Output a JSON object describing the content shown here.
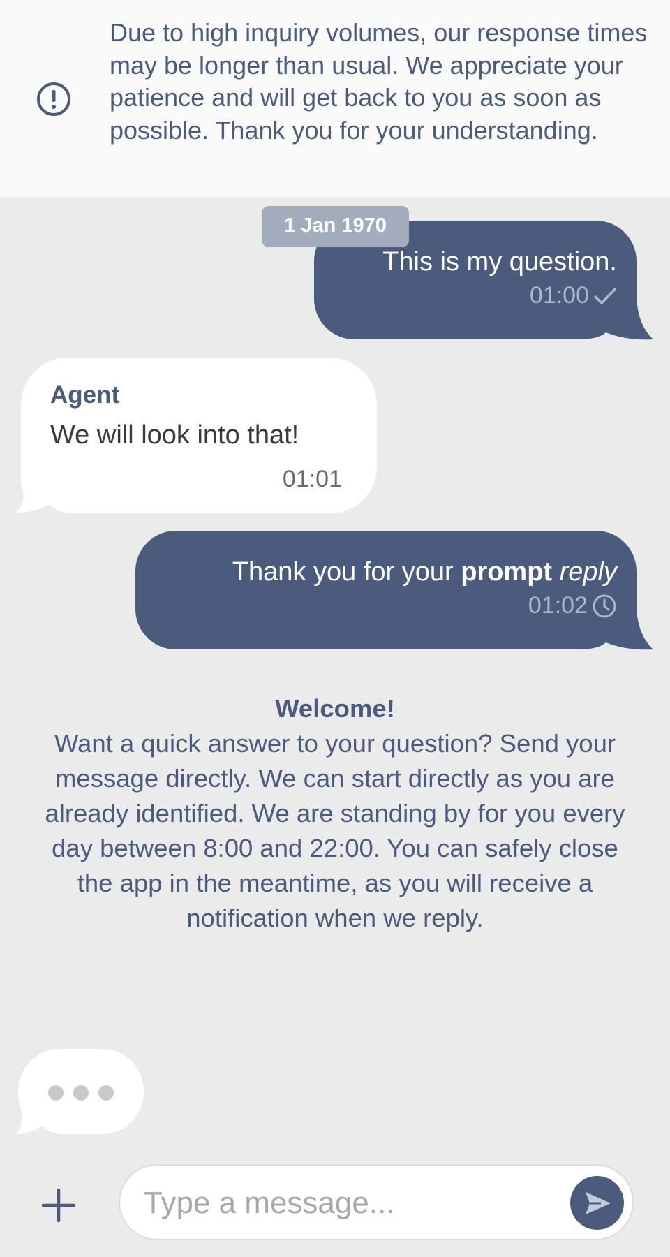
{
  "banner": {
    "icon": "exclamation-circle-icon",
    "text": "Due to high inquiry volumes, our response times may be longer than usual. We appreciate your patience and will get back to you as soon as possible. Thank you for your understanding."
  },
  "date_badge": "1 Jan 1970",
  "messages": [
    {
      "direction": "outgoing",
      "text": "This is my question.",
      "time": "01:00",
      "status_icon": "checkmark-icon"
    },
    {
      "direction": "incoming",
      "sender": "Agent",
      "text": "We will look into that!",
      "time": "01:01"
    },
    {
      "direction": "outgoing",
      "text_parts": {
        "plain": "Thank you for your ",
        "bold": "prompt",
        "space": " ",
        "italic": "reply"
      },
      "time": "01:02",
      "status_icon": "clock-icon"
    }
  ],
  "welcome": {
    "title": "Welcome!",
    "body": "Want a quick answer to your question? Send your message directly. We can start directly as you are already identified. We are standing by for you every day between 8:00 and 22:00. You can safely close the app in the meantime, as you will receive a notification when we reply."
  },
  "typing_indicator": "typing-dots-icon",
  "composer": {
    "add_icon": "plus-icon",
    "placeholder": "Type a message...",
    "value": "",
    "send_icon": "send-arrow-icon"
  },
  "colors": {
    "background": "#ebebeb",
    "banner_bg": "#fafafa",
    "primary": "#4b5b7e",
    "outgoing_bubble": "#4b5b7e",
    "incoming_bubble": "#ffffff",
    "date_badge": "#a3acbd"
  }
}
